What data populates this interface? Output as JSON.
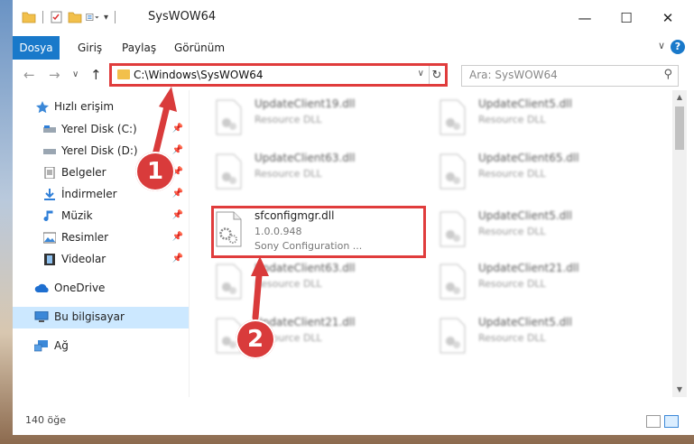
{
  "window": {
    "title": "SysWOW64",
    "controls": [
      "—",
      "☐",
      "✕"
    ]
  },
  "ribbon": {
    "tabs": [
      "Dosya",
      "Giriş",
      "Paylaş",
      "Görünüm"
    ],
    "help_label": "?",
    "collapse_label": "∨"
  },
  "navigation": {
    "back": "←",
    "forward": "→",
    "recent": "∨",
    "up": "↑",
    "address": "C:\\Windows\\SysWOW64",
    "address_dropdown": "∨",
    "refresh": "↻",
    "search_placeholder": "Ara: SysWOW64",
    "search_icon": "⚲"
  },
  "sidebar": {
    "items": [
      {
        "label": "Hızlı erişim",
        "icon": "star-icon",
        "pinned": false
      },
      {
        "label": "Yerel Disk (C:)",
        "icon": "drive-icon",
        "pinned": true
      },
      {
        "label": "Yerel Disk (D:)",
        "icon": "drive-icon",
        "pinned": true
      },
      {
        "label": "Belgeler",
        "icon": "documents-icon",
        "pinned": true
      },
      {
        "label": "İndirmeler",
        "icon": "download-icon",
        "pinned": true
      },
      {
        "label": "Müzik",
        "icon": "music-icon",
        "pinned": true
      },
      {
        "label": "Resimler",
        "icon": "pictures-icon",
        "pinned": true
      },
      {
        "label": "Videolar",
        "icon": "videos-icon",
        "pinned": true
      },
      {
        "label": "OneDrive",
        "icon": "cloud-icon",
        "pinned": false
      },
      {
        "label": "Bu bilgisayar",
        "icon": "computer-icon",
        "pinned": false,
        "selected": true
      },
      {
        "label": "Ağ",
        "icon": "network-icon",
        "pinned": false
      }
    ],
    "pin_glyph": "📌"
  },
  "files": [
    {
      "name": "UpdateClient19.dll",
      "type": "Resource DLL",
      "blurred": true
    },
    {
      "name": "UpdateClient5.dll",
      "type": "Resource DLL",
      "blurred": true
    },
    {
      "name": "UpdateClient63.dll",
      "type": "Resource DLL",
      "blurred": true
    },
    {
      "name": "UpdateClient65.dll",
      "type": "Resource DLL",
      "blurred": true
    },
    {
      "name": "sfconfigmgr.dll",
      "version": "1.0.0.948",
      "type": "Sony Configuration ...",
      "blurred": false
    },
    {
      "name": "UpdateClient5.dll",
      "type": "Resource DLL",
      "blurred": true
    },
    {
      "name": "UpdateClient63.dll",
      "type": "Resource DLL",
      "blurred": true
    },
    {
      "name": "UpdateClient21.dll",
      "type": "Resource DLL",
      "blurred": true
    },
    {
      "name": "UpdateClient21.dll",
      "type": "Resource DLL",
      "blurred": true
    },
    {
      "name": "UpdateClient5.dll",
      "type": "Resource DLL",
      "blurred": true
    }
  ],
  "status": {
    "count": "140 öğe"
  },
  "annotations": {
    "step1": "1",
    "step2": "2",
    "color": "#e03c3c"
  },
  "colors": {
    "accent": "#1979ca",
    "selection": "#cce8ff",
    "folder": "#f2c04b"
  }
}
